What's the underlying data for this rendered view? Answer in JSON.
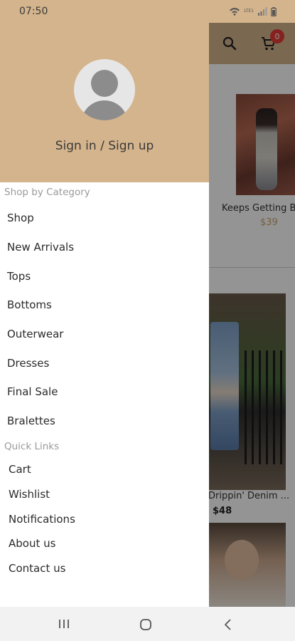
{
  "status_bar": {
    "time": "07:50",
    "network_label": "LTE1"
  },
  "background": {
    "cart_count": "0",
    "products": [
      {
        "name": "Keeps Getting Bo",
        "price": "$39"
      },
      {
        "name": "Drippin' Denim ...",
        "price": "$48"
      }
    ]
  },
  "drawer": {
    "signin_label": "Sign in / Sign up",
    "shop_heading": "Shop by Category",
    "categories": [
      "Shop",
      "New Arrivals",
      "Tops",
      "Bottoms",
      "Outerwear",
      "Dresses",
      "Final Sale",
      "Bralettes"
    ],
    "links_heading": "Quick Links",
    "quick_links": [
      "Cart",
      "Wishlist",
      "Notifications",
      "About us",
      "Contact us"
    ]
  },
  "colors": {
    "header_tan": "#d4b48c",
    "badge_red": "#e53935",
    "price_gold": "#c9a46a"
  },
  "icons": [
    "wifi-icon",
    "signal-icon",
    "battery-icon",
    "search-icon",
    "cart-icon",
    "avatar-icon",
    "recent-apps-icon",
    "home-icon",
    "back-icon"
  ]
}
